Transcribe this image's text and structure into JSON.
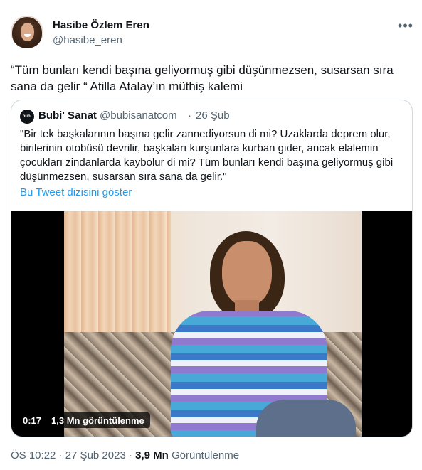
{
  "author": {
    "name": "Hasibe Özlem Eren",
    "handle": "@hasibe_eren",
    "avatar_icon": "profile-photo"
  },
  "more_icon": "•••",
  "tweet_text": "“Tüm bunları kendi başına geliyormuş gibi düşünmezsen, susarsan sıra sana da gelir “ Atilla Atalay’ın müthiş kalemi",
  "quoted_tweet": {
    "avatar_text": "bubi",
    "name": "Bubi' Sanat",
    "handle": "@bubisanatcom",
    "separator": "·",
    "date": "26 Şub",
    "text": "\"Bir tek başkalarının başına gelir zannediyorsun di mi? Uzaklarda deprem olur, birilerinin otobüsü devrilir, başkaları kurşunlara kurban gider, ancak elalemin çocukları zindanlarda kaybolur di mi? Tüm bunları kendi başına geliyormuş gibi düşünmezsen, susarsan sıra sana da gelir.\"",
    "thread_link": "Bu Tweet dizisini göster",
    "video": {
      "time": "0:17",
      "views": "1,3 Mn görüntülenme"
    }
  },
  "meta": {
    "time_date": "ÖS 10:22 · 27 Şub 2023 · ",
    "view_count": "3,9 Mn",
    "view_label": " Görüntülenme"
  },
  "colors": {
    "text": "#0f1419",
    "secondary": "#536471",
    "link": "#1d9bf0",
    "border": "#cfd9de"
  }
}
